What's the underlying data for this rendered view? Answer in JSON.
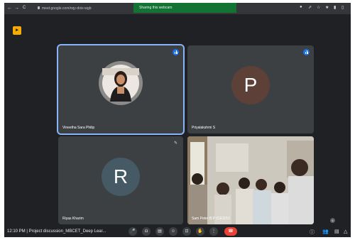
{
  "browser": {
    "back_glyph": "←",
    "forward_glyph": "→",
    "reload_glyph": "C",
    "url": "meet.google.com/nqy-doix-wgb",
    "ext_icons": [
      "●",
      "⇗",
      "☆",
      "★",
      "▮",
      "▯"
    ]
  },
  "banner": {
    "text": "Sharing this webcam"
  },
  "app_badge": {
    "glyph": "▸"
  },
  "tiles": [
    {
      "name": "Vineetha Sara Philip",
      "type": "photo",
      "speaking": true
    },
    {
      "name": "Priyalakshmi S",
      "type": "avatar",
      "letter": "P",
      "avatar_color": "#5d4037",
      "speaking": true
    },
    {
      "name": "Riyas Kharim",
      "type": "avatar",
      "letter": "R",
      "avatar_color": "#455a64",
      "muted": true
    },
    {
      "name": "Sam Peter B.P (CE1153",
      "type": "video"
    }
  ],
  "bottom_bar": {
    "time": "12:10 PM",
    "separator": "|",
    "meeting_title": "Project discussion_MBCET_Deep Lear...",
    "controls": [
      "mic-icon",
      "camera-icon",
      "captions-icon",
      "emoji-icon",
      "present-icon",
      "raise-hand-icon",
      "more-icon",
      "end-call-icon"
    ],
    "control_glyphs": [
      "🎤",
      "◘",
      "▤",
      "☺",
      "⊡",
      "✋",
      "⋮",
      "☎"
    ],
    "right_glyphs": [
      "ⓘ",
      "👥",
      "▤",
      "△"
    ],
    "participant_count": "6"
  },
  "colors": {
    "background": "#202124",
    "tile": "#3c4043",
    "active_outline": "#8ab4f8",
    "end_call": "#ea4335"
  }
}
